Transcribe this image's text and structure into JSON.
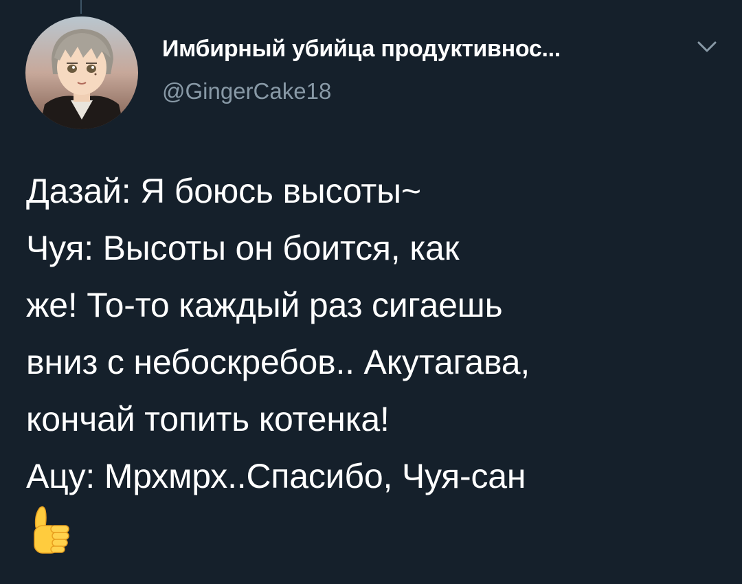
{
  "tweet": {
    "author": {
      "display_name": "Имбирный убийца продуктивнос...",
      "handle": "@GingerCake18",
      "avatar_icon": "anime-avatar"
    },
    "menu_icon": "chevron-down-icon",
    "text_lines": [
      "Дазай: Я боюсь высоты~",
      "Чуя: Высоты он боится, как",
      "же! То-то каждый раз сигаешь",
      "вниз с небоскребов.. Акутагава,",
      "кончай топить котенка!",
      "Ацу: Мрхмрх..Спасибо, Чуя-сан"
    ],
    "emoji": "thumbs-up-icon"
  },
  "colors": {
    "background": "#15202b",
    "text_primary": "#ffffff",
    "text_secondary": "#8899a6",
    "thread_line": "#3d5466"
  }
}
